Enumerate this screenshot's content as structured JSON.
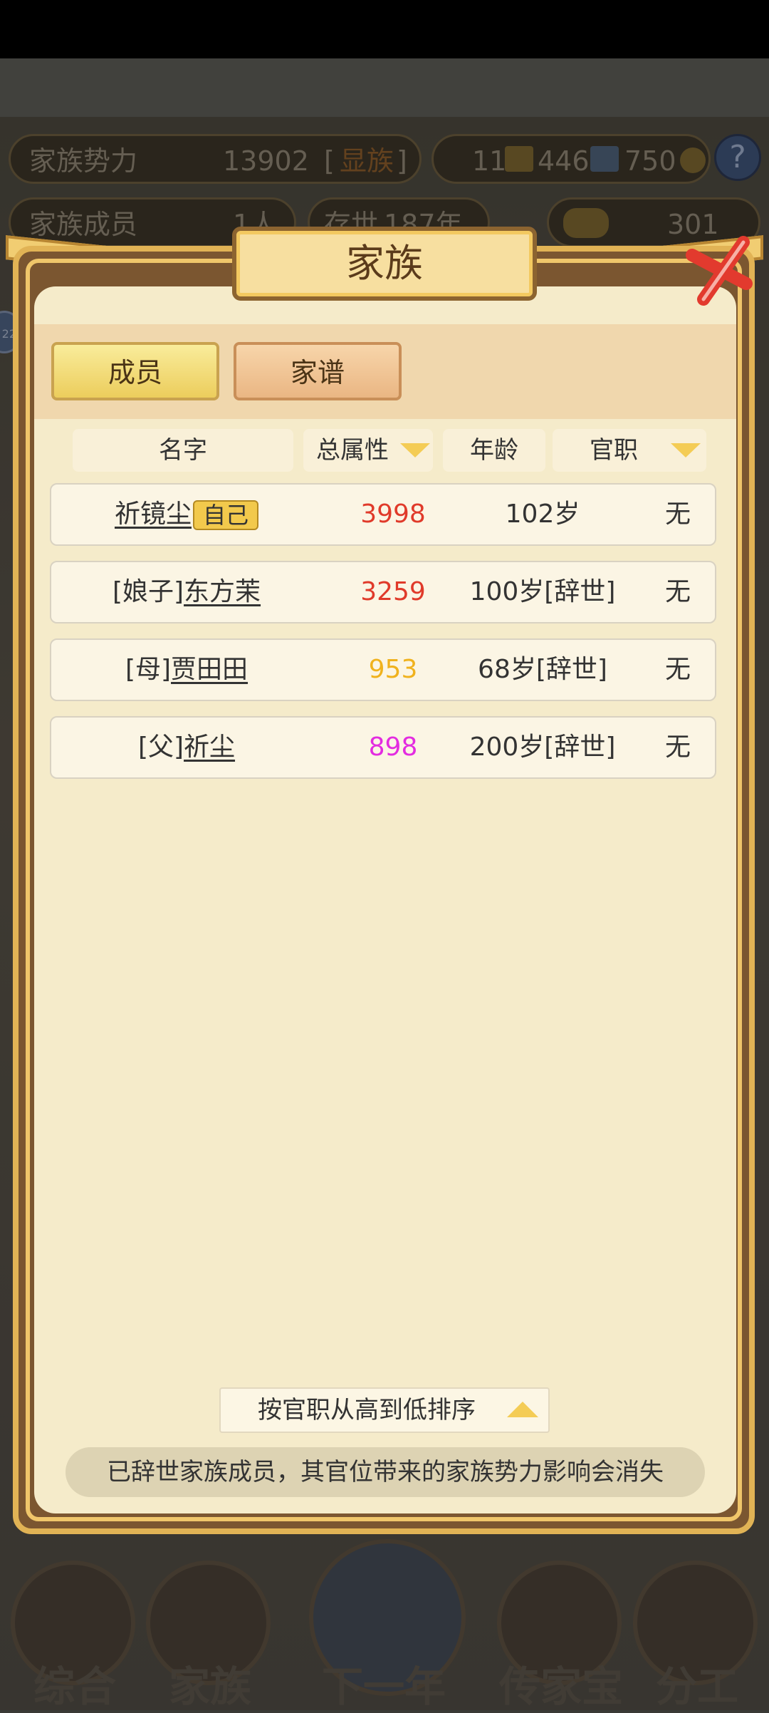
{
  "hud": {
    "power_label": "家族势力",
    "power_value": "13902",
    "power_rank": "显族",
    "currency_a": "11",
    "currency_b": "446",
    "currency_c": "750",
    "members_label": "家族成员",
    "members_value": "1人",
    "existence_label": "存世",
    "existence_value": "187年",
    "gold_value": "301",
    "side_badge": "22"
  },
  "modal": {
    "title": "家族",
    "tabs": [
      {
        "label": "成员",
        "active": true
      },
      {
        "label": "家谱",
        "active": false
      }
    ],
    "columns": [
      "名字",
      "总属性",
      "年龄",
      "官职"
    ],
    "rows": [
      {
        "prefix": "",
        "name": "祈镜尘",
        "badge": "自己",
        "attr": "3998",
        "attr_color": "#e03a2a",
        "age": "102岁",
        "post": "无"
      },
      {
        "prefix": "[娘子]",
        "name": "东方茉",
        "badge": "",
        "attr": "3259",
        "attr_color": "#e03a2a",
        "age": "100岁[辞世]",
        "post": "无"
      },
      {
        "prefix": "[母]",
        "name": "贾田田",
        "badge": "",
        "attr": "953",
        "attr_color": "#f0b21d",
        "age": "68岁[辞世]",
        "post": "无"
      },
      {
        "prefix": "[父]",
        "name": "祈尘",
        "badge": "",
        "attr": "898",
        "attr_color": "#e32ce0",
        "age": "200岁[辞世]",
        "post": "无"
      }
    ],
    "sort_label": "按官职从高到低排序",
    "notice": "已辞世家族成员，其官位带来的家族势力影响会消失"
  },
  "nav": {
    "items": [
      "综合",
      "家族",
      "下一年",
      "传家宝",
      "分工"
    ]
  }
}
